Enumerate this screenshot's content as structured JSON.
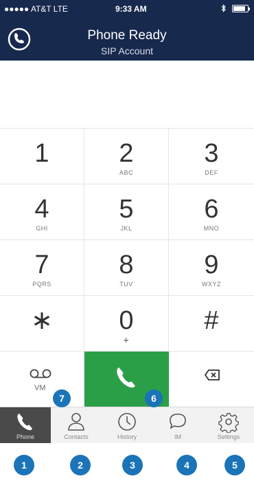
{
  "status_bar": {
    "carrier": "●●●●● AT&T  LTE",
    "time": "9:33 AM",
    "bluetooth": "bluetooth-icon",
    "battery_level": 0.85
  },
  "header": {
    "title": "Phone Ready",
    "subtitle": "SIP Account",
    "logo_icon": "phone-globe-icon"
  },
  "keypad": {
    "keys": [
      {
        "digit": "1",
        "letters": ""
      },
      {
        "digit": "2",
        "letters": "ABC"
      },
      {
        "digit": "3",
        "letters": "DEF"
      },
      {
        "digit": "4",
        "letters": "GHI"
      },
      {
        "digit": "5",
        "letters": "JKL"
      },
      {
        "digit": "6",
        "letters": "MNO"
      },
      {
        "digit": "7",
        "letters": "PQRS"
      },
      {
        "digit": "8",
        "letters": "TUV"
      },
      {
        "digit": "9",
        "letters": "WXYZ"
      },
      {
        "digit": "∗",
        "letters": ""
      },
      {
        "digit": "0",
        "letters": "+"
      },
      {
        "digit": "#",
        "letters": ""
      }
    ],
    "voicemail_label": "VM",
    "call_color": "#2b9f48"
  },
  "tabs": [
    {
      "label": "Phone",
      "icon": "phone-icon"
    },
    {
      "label": "Contacts",
      "icon": "contacts-icon"
    },
    {
      "label": "History",
      "icon": "clock-icon"
    },
    {
      "label": "IM",
      "icon": "chat-bubble-icon"
    },
    {
      "label": "Settings",
      "icon": "gear-icon"
    }
  ],
  "badges": [
    "1",
    "2",
    "3",
    "4",
    "5",
    "6",
    "7"
  ],
  "colors": {
    "header_bg": "#17294d",
    "badge": "#1b73b8",
    "call_green": "#2b9f48"
  }
}
